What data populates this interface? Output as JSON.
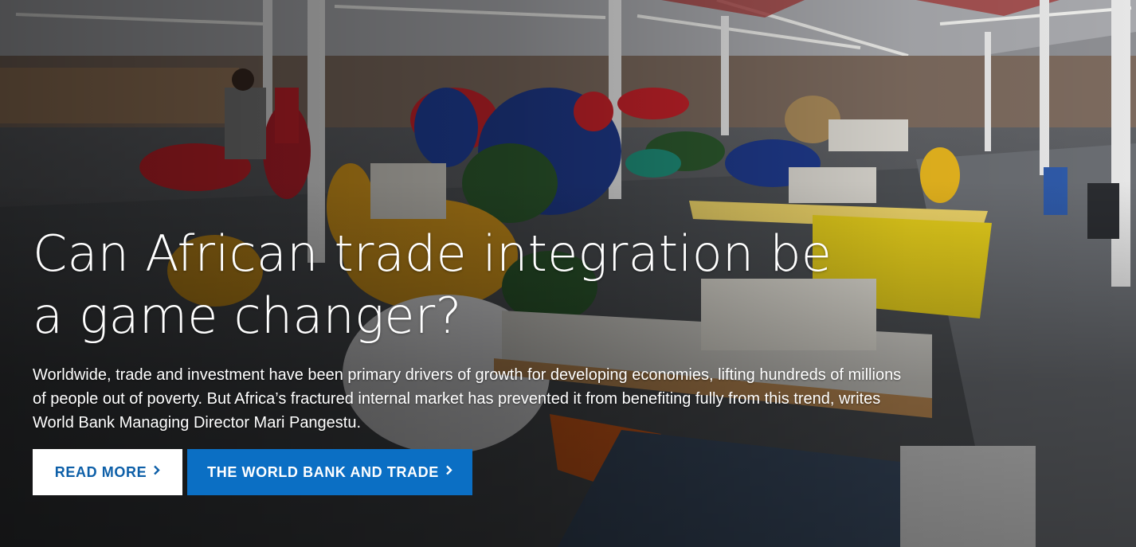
{
  "hero": {
    "image_icon": "garment-factory-photo",
    "headline": "Can African trade integration be a game changer?",
    "summary": "Worldwide, trade and investment have been primary drivers of growth for developing economies, lifting hundreds of millions of people out of poverty. But Africa’s fractured internal market has prevented it from benefiting fully from this trend, writes World Bank Managing Director Mari Pangestu.",
    "primary_button": {
      "label": "READ MORE",
      "icon": "chevron-right-icon"
    },
    "secondary_button": {
      "label": "THE WORLD BANK AND TRADE",
      "icon": "chevron-right-icon"
    }
  },
  "colors": {
    "brand_blue": "#0b6fc4",
    "button_text_blue": "#0d5fa8",
    "white": "#ffffff"
  }
}
